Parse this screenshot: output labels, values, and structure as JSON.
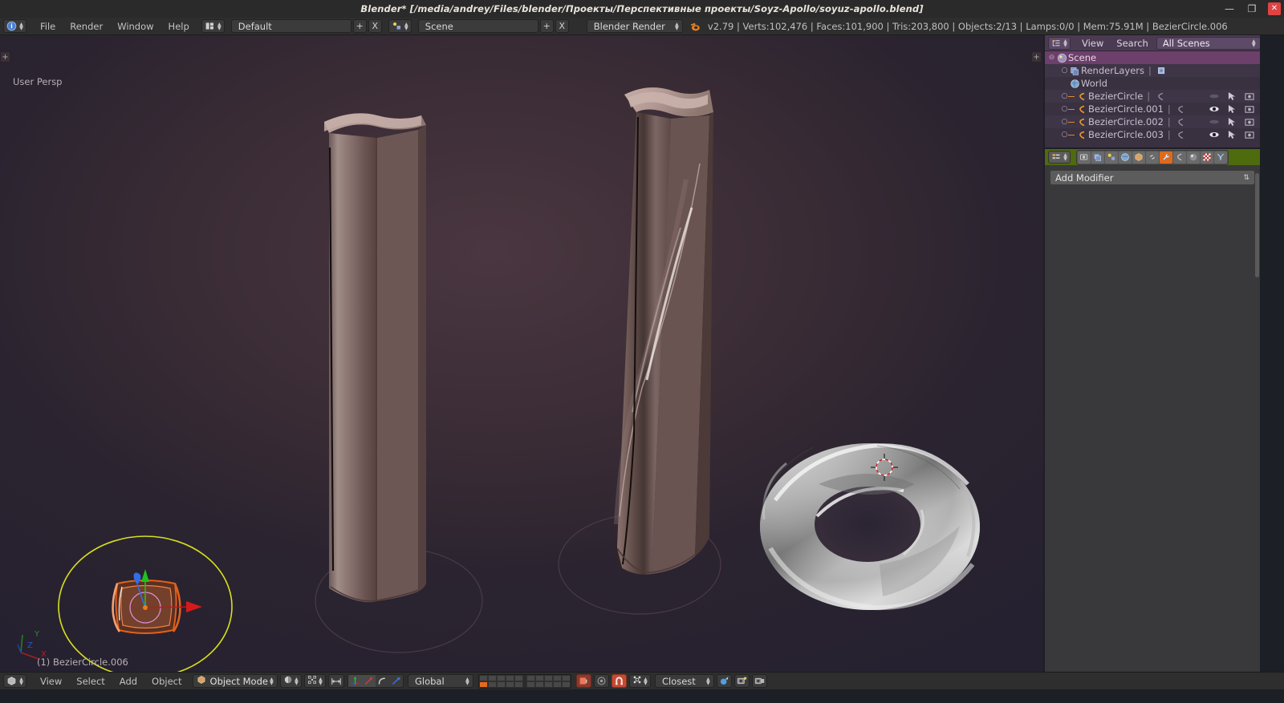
{
  "window": {
    "title": "Blender* [/media/andrey/Files/blender/Проекты/Перспективные проекты/Soyz-Apollo/soyuz-apollo.blend]",
    "minimize": "—",
    "maximize": "❐",
    "close": "✕"
  },
  "info_header": {
    "editor_type_icon": "info-editor-icon",
    "menus": [
      "File",
      "Render",
      "Window",
      "Help"
    ],
    "screen_layout": {
      "icon": "screen-layout-icon",
      "value": "Default",
      "add": "+",
      "remove": "X"
    },
    "scene": {
      "icon": "scene-icon",
      "value": "Scene",
      "add": "+",
      "remove": "X"
    },
    "render_engine": {
      "value": "Blender Render"
    },
    "status": "v2.79 | Verts:102,476 | Faces:101,900 | Tris:203,800 | Objects:2/13 | Lamps:0/0 | Mem:75.91M | BezierCircle.006"
  },
  "viewport": {
    "view_name": "User Persp",
    "object_info": "(1) BezierCircle.006",
    "axis_gizmo": {
      "x_label": "X",
      "y_label": "Y",
      "z_label": "Z"
    },
    "panel_toggle_left": "+",
    "panel_toggle_right": "+"
  },
  "outliner": {
    "header": {
      "editor_type_icon": "outliner-editor-icon",
      "menus": [
        "View",
        "Search"
      ],
      "display_mode": "All Scenes",
      "filter_icon": "magnifier-icon"
    },
    "rows": [
      {
        "label": "Scene",
        "icon": "scene-icon",
        "indent": 0,
        "selected": true,
        "expander": "−",
        "tag": "",
        "eye": "none",
        "cursor": false
      },
      {
        "label": "RenderLayers",
        "icon": "renderlayers-icon",
        "indent": 1,
        "selected": false,
        "expander": "◦",
        "tag": "renderlayer-icon",
        "eye": "none",
        "cursor": false
      },
      {
        "label": "World",
        "icon": "world-icon",
        "indent": 1,
        "selected": false,
        "expander": "",
        "tag": "",
        "eye": "none",
        "cursor": false
      },
      {
        "label": "BezierCircle",
        "icon": "curve-icon",
        "indent": 1,
        "selected": false,
        "expander": "◦",
        "tag": "curve-data-icon",
        "eye": "closed",
        "cursor": true
      },
      {
        "label": "BezierCircle.001",
        "icon": "curve-icon",
        "indent": 1,
        "selected": false,
        "expander": "◦",
        "tag": "curve-data-icon",
        "eye": "open",
        "cursor": true
      },
      {
        "label": "BezierCircle.002",
        "icon": "curve-icon",
        "indent": 1,
        "selected": false,
        "expander": "◦",
        "tag": "curve-data-icon",
        "eye": "closed",
        "cursor": true
      },
      {
        "label": "BezierCircle.003",
        "icon": "curve-icon",
        "indent": 1,
        "selected": false,
        "expander": "◦",
        "tag": "curve-data-icon",
        "eye": "open",
        "cursor": true
      }
    ]
  },
  "properties": {
    "header": {
      "editor_type_icon": "properties-editor-icon",
      "tabs": [
        {
          "name": "render-tab",
          "icon": "camera-back-icon",
          "active": false
        },
        {
          "name": "render-layers-tab",
          "icon": "renderlayers-icon",
          "active": false
        },
        {
          "name": "scene-tab",
          "icon": "scene-icon",
          "active": false
        },
        {
          "name": "world-tab",
          "icon": "world-icon",
          "active": false
        },
        {
          "name": "object-tab",
          "icon": "cube-icon",
          "active": false
        },
        {
          "name": "constraints-tab",
          "icon": "chain-icon",
          "active": false
        },
        {
          "name": "modifiers-tab",
          "icon": "wrench-icon",
          "active": true
        },
        {
          "name": "data-tab",
          "icon": "curve-data-icon",
          "active": false
        },
        {
          "name": "material-tab",
          "icon": "sphere-icon",
          "active": false
        },
        {
          "name": "texture-tab",
          "icon": "checker-icon",
          "active": false
        },
        {
          "name": "particles-tab",
          "icon": "particles-icon",
          "active": false
        }
      ]
    },
    "add_modifier_label": "Add Modifier",
    "add_modifier_arrow": "⇅"
  },
  "view3d_header": {
    "editor_type_icon": "view3d-editor-icon",
    "menus": [
      "View",
      "Select",
      "Add",
      "Object"
    ],
    "mode": {
      "label": "Object Mode",
      "icon": "object-mode-icon"
    },
    "viewport_shading_icon": "shading-solid-icon",
    "pivot_icon": "pivot-median-icon",
    "manipulator": {
      "enabled_icon": "manipulator-icon",
      "translate_icon": "translate-arrow-icon",
      "rotate_icon": "rotate-arc-icon",
      "scale_icon": "scale-icon"
    },
    "transform_orientation": "Global",
    "layers_label": "scene-layers",
    "snap": {
      "magnet_icon": "magnet-icon",
      "snap_element_icon": "snap-vertex-icon",
      "snap_target": "Closest"
    },
    "proportional_icon": "proportional-edit-icon",
    "render_icons": [
      "render-icon",
      "render-ops-icon"
    ],
    "opengl_render_icon": "opengl-render-icon"
  },
  "colors": {
    "accent_orange": "#e87d1e",
    "outliner_purple": "#4b3b52",
    "properties_green": "#4e6b0e",
    "selection_yellow": "#d7e01e",
    "axis_x": "#cc2222",
    "axis_y": "#22cc22",
    "axis_z": "#2255dd",
    "header_grey": "#2e2e2e",
    "viewport_bg": "#3a2c35"
  }
}
